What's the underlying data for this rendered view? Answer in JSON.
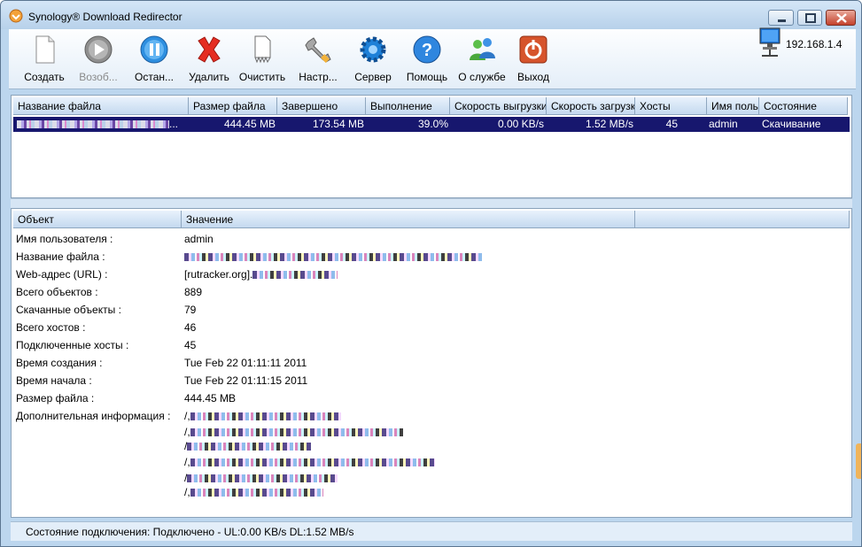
{
  "window": {
    "title": "Synology® Download Redirector"
  },
  "toolbar": {
    "items": [
      {
        "label": "Создать",
        "icon": "new-document-icon",
        "enabled": true
      },
      {
        "label": "Возоб...",
        "icon": "resume-icon",
        "enabled": false
      },
      {
        "label": "Остан...",
        "icon": "pause-icon",
        "enabled": true
      },
      {
        "label": "Удалить",
        "icon": "delete-icon",
        "enabled": true
      },
      {
        "label": "Очистить",
        "icon": "clear-icon",
        "enabled": true
      },
      {
        "label": "Настр...",
        "icon": "settings-wrench-icon",
        "enabled": true
      },
      {
        "label": "Сервер",
        "icon": "server-gear-icon",
        "enabled": true
      },
      {
        "label": "Помощь",
        "icon": "help-icon",
        "enabled": true
      },
      {
        "label": "О службе",
        "icon": "users-icon",
        "enabled": true
      },
      {
        "label": "Выход",
        "icon": "power-icon",
        "enabled": true
      }
    ],
    "server_ip": "192.168.1.4"
  },
  "downloads": {
    "columns": [
      "Название файла",
      "Размер файла",
      "Завершено",
      "Выполнение",
      "Скорость выгрузки",
      "Скорость загрузки",
      "Хосты",
      "Имя пользователя",
      "Состояние"
    ],
    "rows": [
      {
        "name_suffix": "...",
        "size": "444.45 MB",
        "completed": "173.54 MB",
        "progress": "39.0%",
        "upload_speed": "0.00 KB/s",
        "download_speed": "1.52 MB/s",
        "hosts": "45",
        "user": "admin",
        "status": "Скачивание"
      }
    ]
  },
  "details": {
    "columns": [
      "Объект",
      "Значение",
      ""
    ],
    "rows": [
      {
        "key": "Имя пользователя :",
        "value": "admin"
      },
      {
        "key": "Название файла :",
        "value": ""
      },
      {
        "key": "Web-адрес (URL) :",
        "value": "[rutracker.org]."
      },
      {
        "key": "Всего объектов :",
        "value": "889"
      },
      {
        "key": "Скачанные объекты :",
        "value": "79"
      },
      {
        "key": "Всего хостов :",
        "value": "46"
      },
      {
        "key": "Подключенные хосты :",
        "value": "45"
      },
      {
        "key": "Время создания :",
        "value": "Tue Feb 22 01:11:11 2011"
      },
      {
        "key": "Время начала :",
        "value": "Tue Feb 22 01:11:15 2011"
      },
      {
        "key": "Размер файла :",
        "value": "444.45 MB"
      },
      {
        "key": "Дополнительная информация :",
        "value": "/,"
      }
    ],
    "extra_lines": [
      "/,",
      "/",
      "/,",
      "/",
      "/,"
    ]
  },
  "status": {
    "text": "Состояние подключения: Подключено - UL:0.00 KB/s  DL:1.52 MB/s"
  }
}
